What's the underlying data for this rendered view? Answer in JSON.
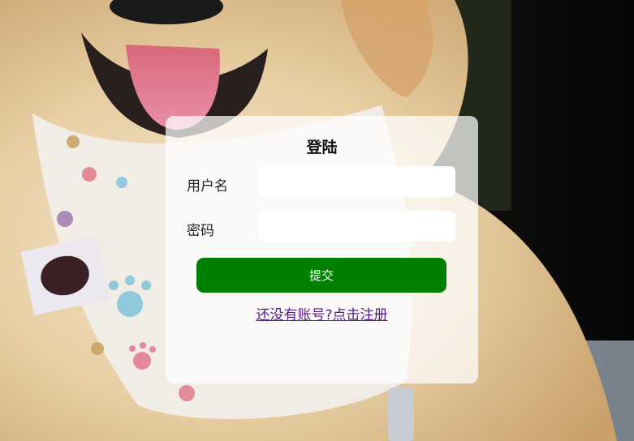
{
  "background": {
    "image": "golden-retriever-puppy-photo"
  },
  "login_form": {
    "title": "登陆",
    "username_label": "用户名",
    "username_value": "",
    "password_label": "密码",
    "password_value": "",
    "submit_label": "提交",
    "register_link_text": "还没有账号?点击注册"
  },
  "colors": {
    "submit_button": "#008000",
    "link": "#551a8b",
    "card": "rgba(255,255,255,0.72)"
  }
}
